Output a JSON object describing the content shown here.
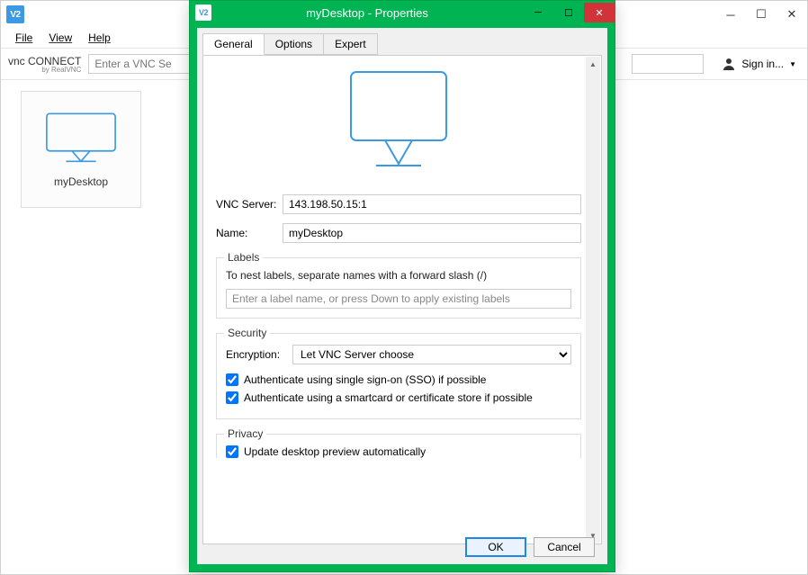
{
  "main": {
    "menu": {
      "file": "File",
      "view": "View",
      "help": "Help"
    },
    "brand_top": "vnc CONNECT",
    "brand_sub": "by RealVNC",
    "search_placeholder": "Enter a VNC Se",
    "signin": "Sign in...",
    "tile_label": "myDesktop"
  },
  "modal": {
    "title": "myDesktop - Properties",
    "tabs": {
      "general": "General",
      "options": "Options",
      "expert": "Expert"
    },
    "vnc_server_label": "VNC Server:",
    "vnc_server_value": "143.198.50.15:1",
    "name_label": "Name:",
    "name_value": "myDesktop",
    "labels": {
      "legend": "Labels",
      "hint": "To nest labels, separate names with a forward slash (/)",
      "placeholder": "Enter a label name, or press Down to apply existing labels"
    },
    "security": {
      "legend": "Security",
      "encryption_label": "Encryption:",
      "encryption_value": "Let VNC Server choose",
      "sso": "Authenticate using single sign-on (SSO) if possible",
      "smartcard": "Authenticate using a smartcard or certificate store if possible"
    },
    "privacy": {
      "legend": "Privacy",
      "update": "Update desktop preview automatically"
    },
    "ok": "OK",
    "cancel": "Cancel"
  }
}
